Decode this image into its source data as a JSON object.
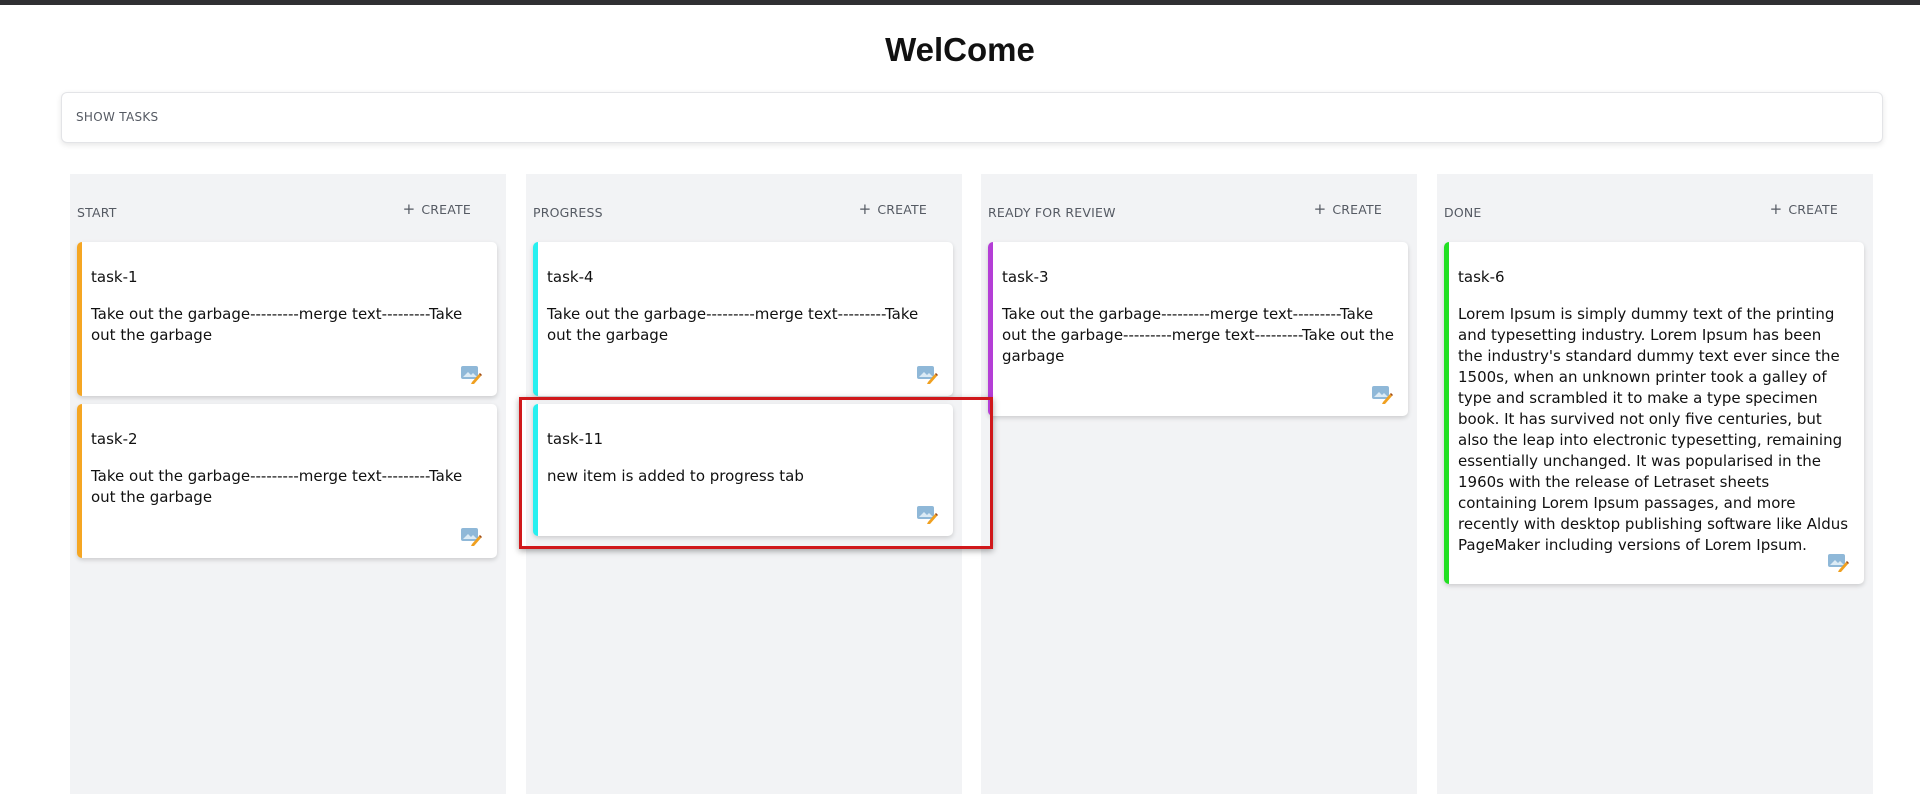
{
  "header": {
    "title": "WelCome"
  },
  "toolbar": {
    "show_tasks_label": "SHOW TASKS"
  },
  "columns": [
    {
      "title": "START",
      "create_label": "CREATE",
      "accent": "#f5a623",
      "cards": [
        {
          "title": "task-1",
          "description": "Take out the garbage---------merge text---------Take out the garbage"
        },
        {
          "title": "task-2",
          "description": "Take out the garbage---------merge text---------Take out the garbage"
        }
      ]
    },
    {
      "title": "PROGRESS",
      "create_label": "CREATE",
      "accent": "#27f0f0",
      "cards": [
        {
          "title": "task-4",
          "description": "Take out the garbage---------merge text---------Take out the garbage"
        },
        {
          "title": "task-11",
          "description": "new item is added to progress tab"
        }
      ]
    },
    {
      "title": "READY FOR REVIEW",
      "create_label": "CREATE",
      "accent": "#b43ed6",
      "cards": [
        {
          "title": "task-3",
          "description": "Take out the garbage---------merge text---------Take out the garbage---------merge text---------Take out the garbage"
        }
      ]
    },
    {
      "title": "DONE",
      "create_label": "CREATE",
      "accent": "#22e022",
      "cards": [
        {
          "title": "task-6",
          "description": "Lorem Ipsum is simply dummy text of the printing and typesetting industry. Lorem Ipsum has been the industry's standard dummy text ever since the 1500s, when an unknown printer took a galley of type and scrambled it to make a type specimen book. It has survived not only five centuries, but also the leap into electronic typesetting, remaining essentially unchanged. It was popularised in the 1960s with the release of Letraset sheets containing Lorem Ipsum passages, and more recently with desktop publishing software like Aldus PageMaker including versions of Lorem Ipsum."
        }
      ]
    }
  ],
  "icons": {
    "card_edit": "edit-image-icon",
    "create": "plus-icon"
  },
  "annotation": {
    "highlight_color": "#d0181b"
  }
}
